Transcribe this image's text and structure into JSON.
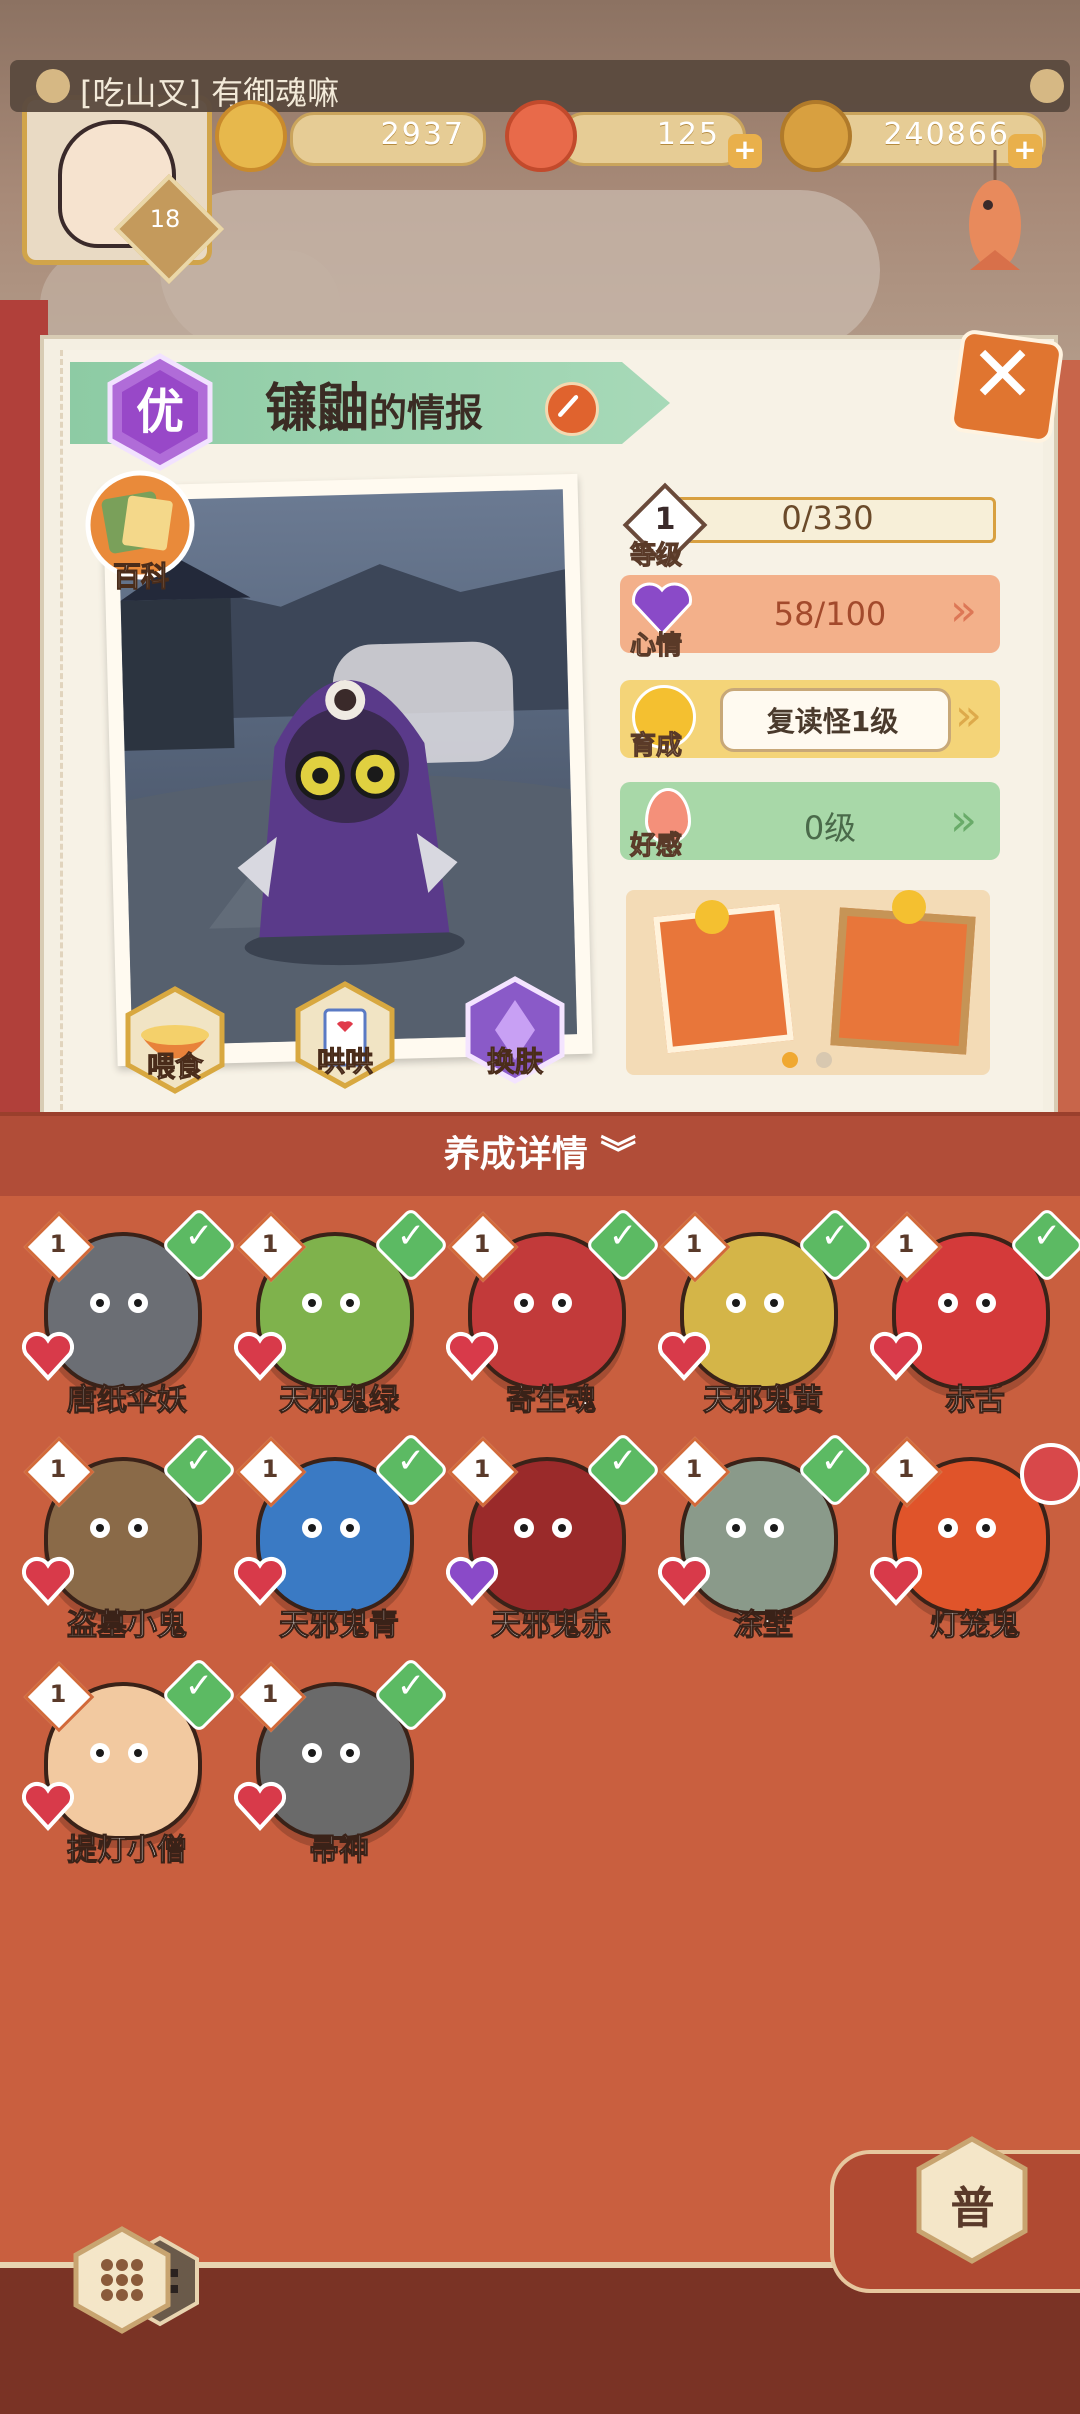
{
  "player": {
    "name": "[吃山叉] 有御魂嘛",
    "level": "18"
  },
  "resources": [
    {
      "name": "stamina",
      "value": "2937",
      "icon": "pine-icon",
      "has_plus": false
    },
    {
      "name": "food",
      "value": "125",
      "icon": "food-icon",
      "has_plus": true
    },
    {
      "name": "coins",
      "value": "240866",
      "icon": "coin-icon",
      "has_plus": true
    }
  ],
  "detail": {
    "rank": "优",
    "name": "镰鼬",
    "title_suffix": "的情报",
    "baike_label": "百科",
    "actions": [
      {
        "label": "喂食",
        "icon": "noodle-bowl-icon"
      },
      {
        "label": "哄哄",
        "icon": "milk-carton-icon"
      },
      {
        "label": "换肤",
        "icon": "skin-icon"
      }
    ],
    "stats": {
      "level": {
        "label": "等级",
        "badge": "1",
        "value": "0/330",
        "progress": 0
      },
      "mood": {
        "label": "心情",
        "value": "58/100"
      },
      "nurture": {
        "label": "育成",
        "value": "复读怪1级"
      },
      "affection": {
        "label": "好感",
        "value": "0级"
      }
    },
    "frames_page": {
      "current": 1,
      "total": 2
    }
  },
  "section": {
    "title": "养成详情"
  },
  "monsters": [
    {
      "name": "唐纸伞妖",
      "level": "1",
      "checked": true,
      "color": "#6b6e74"
    },
    {
      "name": "天邪鬼绿",
      "level": "1",
      "checked": true,
      "color": "#7fb24c"
    },
    {
      "name": "寄生魂",
      "level": "1",
      "checked": true,
      "color": "#c23a3a"
    },
    {
      "name": "天邪鬼黄",
      "level": "1",
      "checked": true,
      "color": "#d4b548"
    },
    {
      "name": "赤舌",
      "level": "1",
      "checked": true,
      "color": "#d43a3a"
    },
    {
      "name": "盗墓小鬼",
      "level": "1",
      "checked": true,
      "color": "#8a6a48"
    },
    {
      "name": "天邪鬼青",
      "level": "1",
      "checked": true,
      "color": "#3a7ac4"
    },
    {
      "name": "天邪鬼赤",
      "level": "1",
      "checked": true,
      "color": "#9a2a2a"
    },
    {
      "name": "涂壁",
      "level": "1",
      "checked": true,
      "color": "#8a9a8a"
    },
    {
      "name": "灯笼鬼",
      "level": "1",
      "checked": false,
      "color": "#e0542a"
    },
    {
      "name": "提灯小僧",
      "level": "1",
      "checked": true,
      "color": "#f2c9a0"
    },
    {
      "name": "帚神",
      "level": "1",
      "checked": true,
      "color": "#6a6a6a"
    }
  ],
  "bottom": {
    "rarity_label": "普"
  }
}
